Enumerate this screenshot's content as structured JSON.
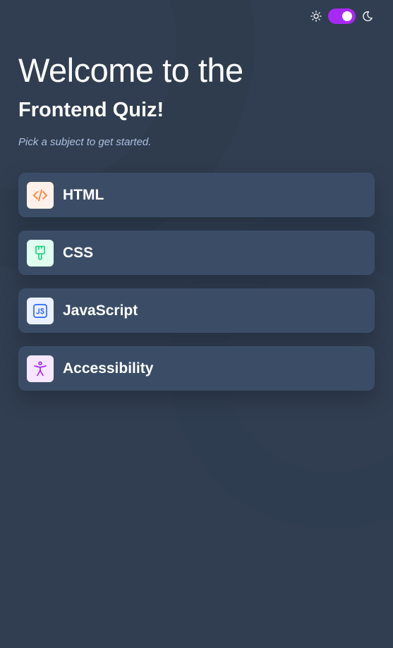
{
  "header": {
    "title_light": "Welcome to the",
    "title_bold": "Frontend Quiz!",
    "subtitle": "Pick a subject to get started."
  },
  "theme": {
    "mode": "dark",
    "light_icon": "sun-icon",
    "dark_icon": "moon-icon",
    "accent": "#a729f5"
  },
  "subjects": [
    {
      "label": "HTML",
      "icon": "code-brackets-icon",
      "icon_bg": "#fff1e9",
      "icon_color": "#ff7e35"
    },
    {
      "label": "CSS",
      "icon": "paintbrush-icon",
      "icon_bg": "#e0fdef",
      "icon_color": "#26d782"
    },
    {
      "label": "JavaScript",
      "icon": "js-icon",
      "icon_bg": "#ebf0ff",
      "icon_color": "#306aff"
    },
    {
      "label": "Accessibility",
      "icon": "accessibility-icon",
      "icon_bg": "#f6e7ff",
      "icon_color": "#a729f5"
    }
  ],
  "colors": {
    "background": "#313e51",
    "card": "#3b4d66",
    "subtitle": "#abc1e1"
  }
}
